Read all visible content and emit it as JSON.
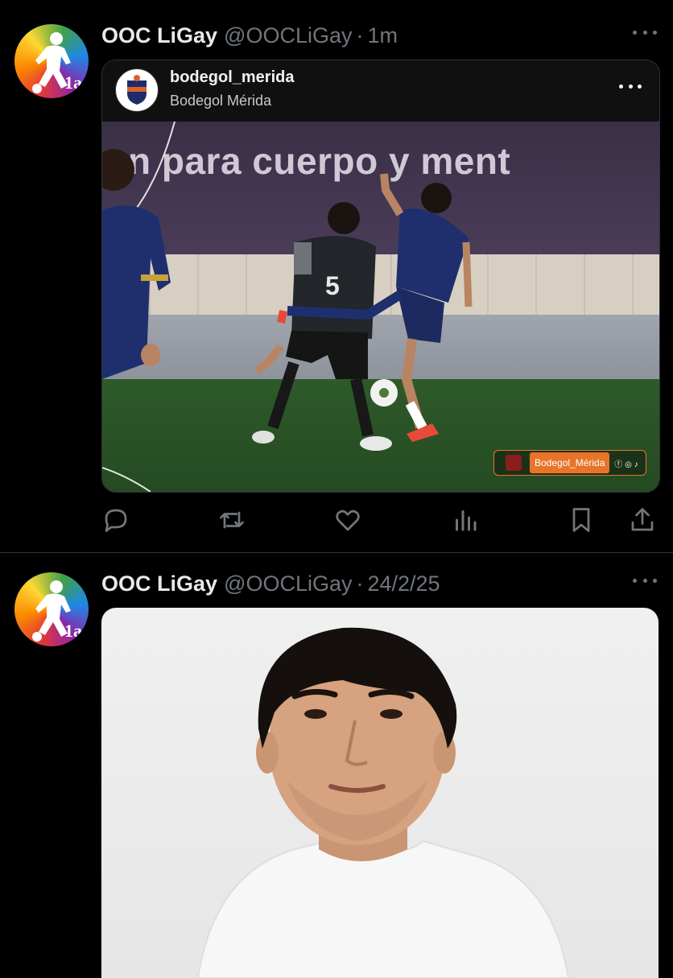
{
  "tweets": [
    {
      "display_name": "OOC LiGay",
      "handle": "@OOCLiGay",
      "separator": "·",
      "time": "1m",
      "avatar_text": "1a",
      "embed": {
        "username": "bodegol_merida",
        "full_name": "Bodegol Mérida",
        "banner_text": "n para cuerpo y ment",
        "jersey_number": "5",
        "watermark": "Bodegol_Mérida",
        "watermark_icons": "ⓕ ◎ ♪"
      },
      "actions": [
        "reply-icon",
        "retweet-icon",
        "like-icon",
        "views-icon",
        "bookmark-icon",
        "share-icon"
      ]
    },
    {
      "display_name": "OOC LiGay",
      "handle": "@OOCLiGay",
      "separator": "·",
      "time": "24/2/25",
      "avatar_text": "1a"
    }
  ],
  "colors": {
    "background": "#000000",
    "text_primary": "#e7e9ea",
    "text_secondary": "#71767b",
    "divider": "#2f3336",
    "watermark_orange": "#e8742a"
  }
}
